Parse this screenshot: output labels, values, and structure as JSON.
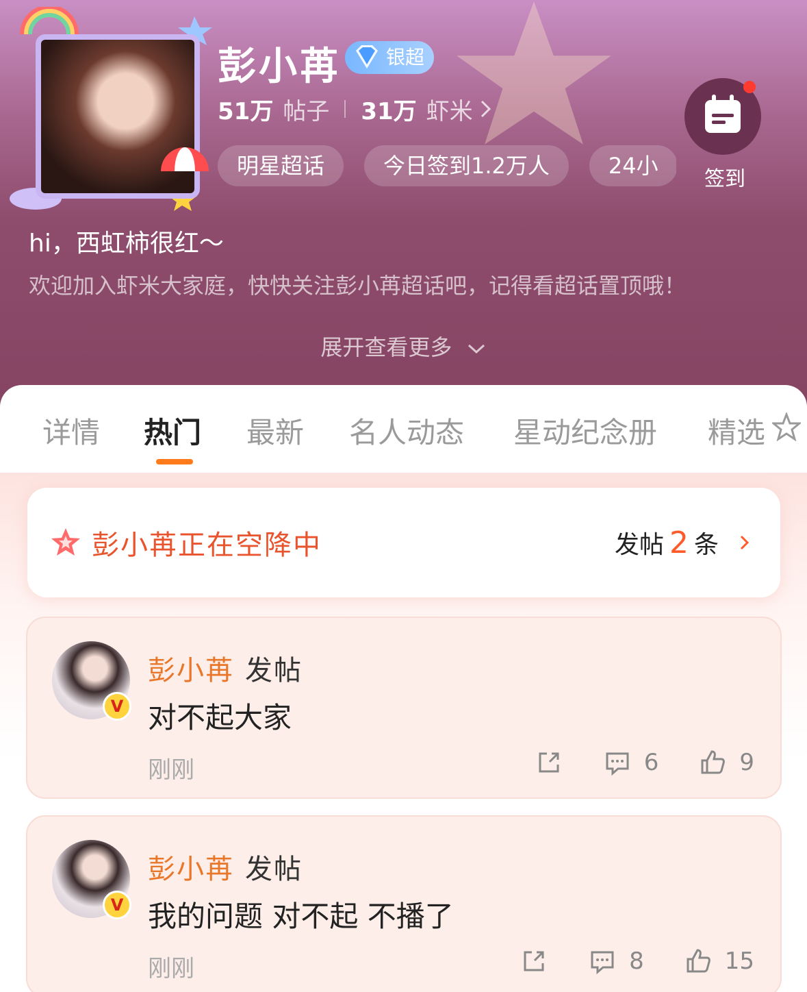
{
  "header": {
    "title": "彭小苒",
    "badge": "银超",
    "stats": {
      "posts_num": "51万",
      "posts_unit": "帖子",
      "fans_num": "31万",
      "fans_unit": "虾米"
    },
    "chips": [
      "明星超话",
      "今日签到1.2万人",
      "24小"
    ],
    "checkin_label": "签到",
    "greeting": "hi，西虹柿很红～",
    "welcome": "欢迎加入虾米大家庭，快快关注彭小苒超话吧，记得看超话置顶哦！",
    "expand": "展开查看更多"
  },
  "tabs": [
    "详情",
    "热门",
    "最新",
    "名人动态",
    "星动纪念册",
    "精选"
  ],
  "active_tab": "热门",
  "airdrop": {
    "title": "彭小苒正在空降中",
    "prefix": "发帖",
    "count": "2",
    "suffix": "条"
  },
  "posts": [
    {
      "author": "彭小苒",
      "action": "发帖",
      "text": "对不起大家",
      "time": "刚刚",
      "comments": "6",
      "likes": "9"
    },
    {
      "author": "彭小苒",
      "action": "发帖",
      "text": "我的问题 对不起 不播了",
      "time": "刚刚",
      "comments": "8",
      "likes": "15"
    }
  ],
  "colors": {
    "accent": "#ff7a1a",
    "author": "#e8772a",
    "airdrop": "#e8542d",
    "header_top": "#c98fc4",
    "header_bottom": "#864463"
  }
}
